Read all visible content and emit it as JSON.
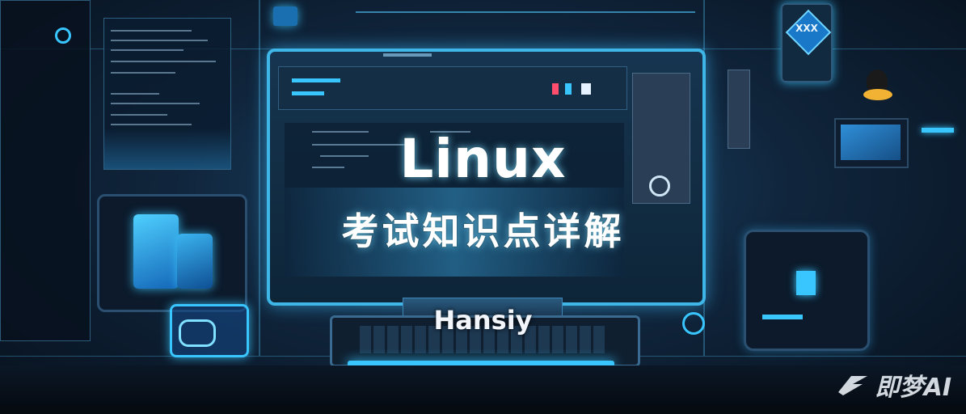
{
  "image": {
    "title": "Linux",
    "subtitle": "考试知识点详解",
    "author": "Hansiy",
    "watermark": "即梦AI",
    "badge_text": "XXX"
  },
  "colors": {
    "accent": "#39c6ff",
    "background": "#0a1626",
    "text": "#ffffff"
  },
  "icons": [
    "monitor-icon",
    "keyboard-icon",
    "penguin-icon",
    "logo-icon"
  ]
}
